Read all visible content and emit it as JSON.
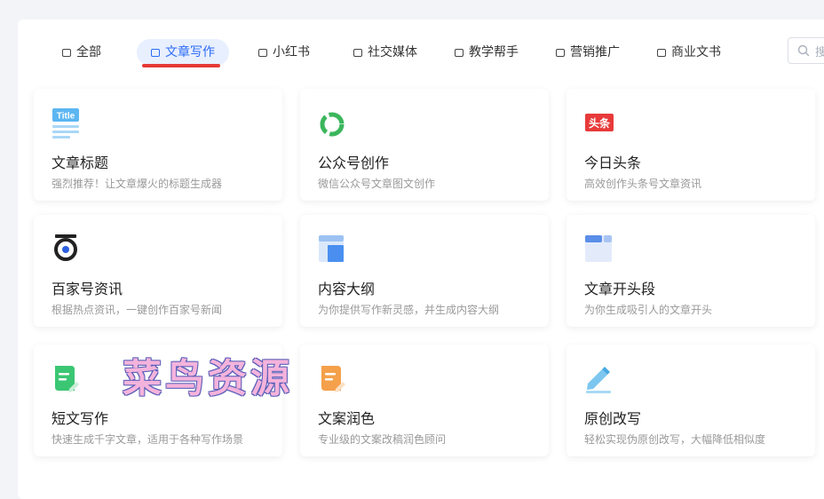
{
  "tabs": [
    {
      "label": "全部"
    },
    {
      "label": "文章写作"
    },
    {
      "label": "小红书"
    },
    {
      "label": "社交媒体"
    },
    {
      "label": "教学帮手"
    },
    {
      "label": "营销推广"
    },
    {
      "label": "商业文书"
    }
  ],
  "active_tab": "文章写作",
  "search": {
    "placeholder": "搜"
  },
  "cards": [
    {
      "title": "文章标题",
      "desc": "强烈推荐！让文章爆火的标题生成器",
      "icon": "title-icon",
      "icon_text": "Title"
    },
    {
      "title": "公众号创作",
      "desc": "微信公众号文章图文创作",
      "icon": "wechat-official-icon"
    },
    {
      "title": "今日头条",
      "desc": "高效创作头条号文章资讯",
      "icon": "toutiao-icon",
      "icon_text": "头条"
    },
    {
      "title": "百家号资讯",
      "desc": "根据热点资讯，一键创作百家号新闻",
      "icon": "baijiahao-icon"
    },
    {
      "title": "内容大纲",
      "desc": "为你提供写作新灵感，并生成内容大纲",
      "icon": "outline-icon"
    },
    {
      "title": "文章开头段",
      "desc": "为你生成吸引人的文章开头",
      "icon": "opening-paragraph-icon"
    },
    {
      "title": "短文写作",
      "desc": "快速生成千字文章，适用于各种写作场景",
      "icon": "short-article-icon"
    },
    {
      "title": "文案润色",
      "desc": "专业级的文案改稿润色顾问",
      "icon": "polish-icon"
    },
    {
      "title": "原创改写",
      "desc": "轻松实现伪原创改写，大幅降低相似度",
      "icon": "rewrite-pen-icon"
    }
  ],
  "watermark": "菜鸟资源",
  "colors": {
    "accent": "#2b6cf6",
    "active_tab_bg": "#e8effe",
    "underline": "#e53935"
  }
}
